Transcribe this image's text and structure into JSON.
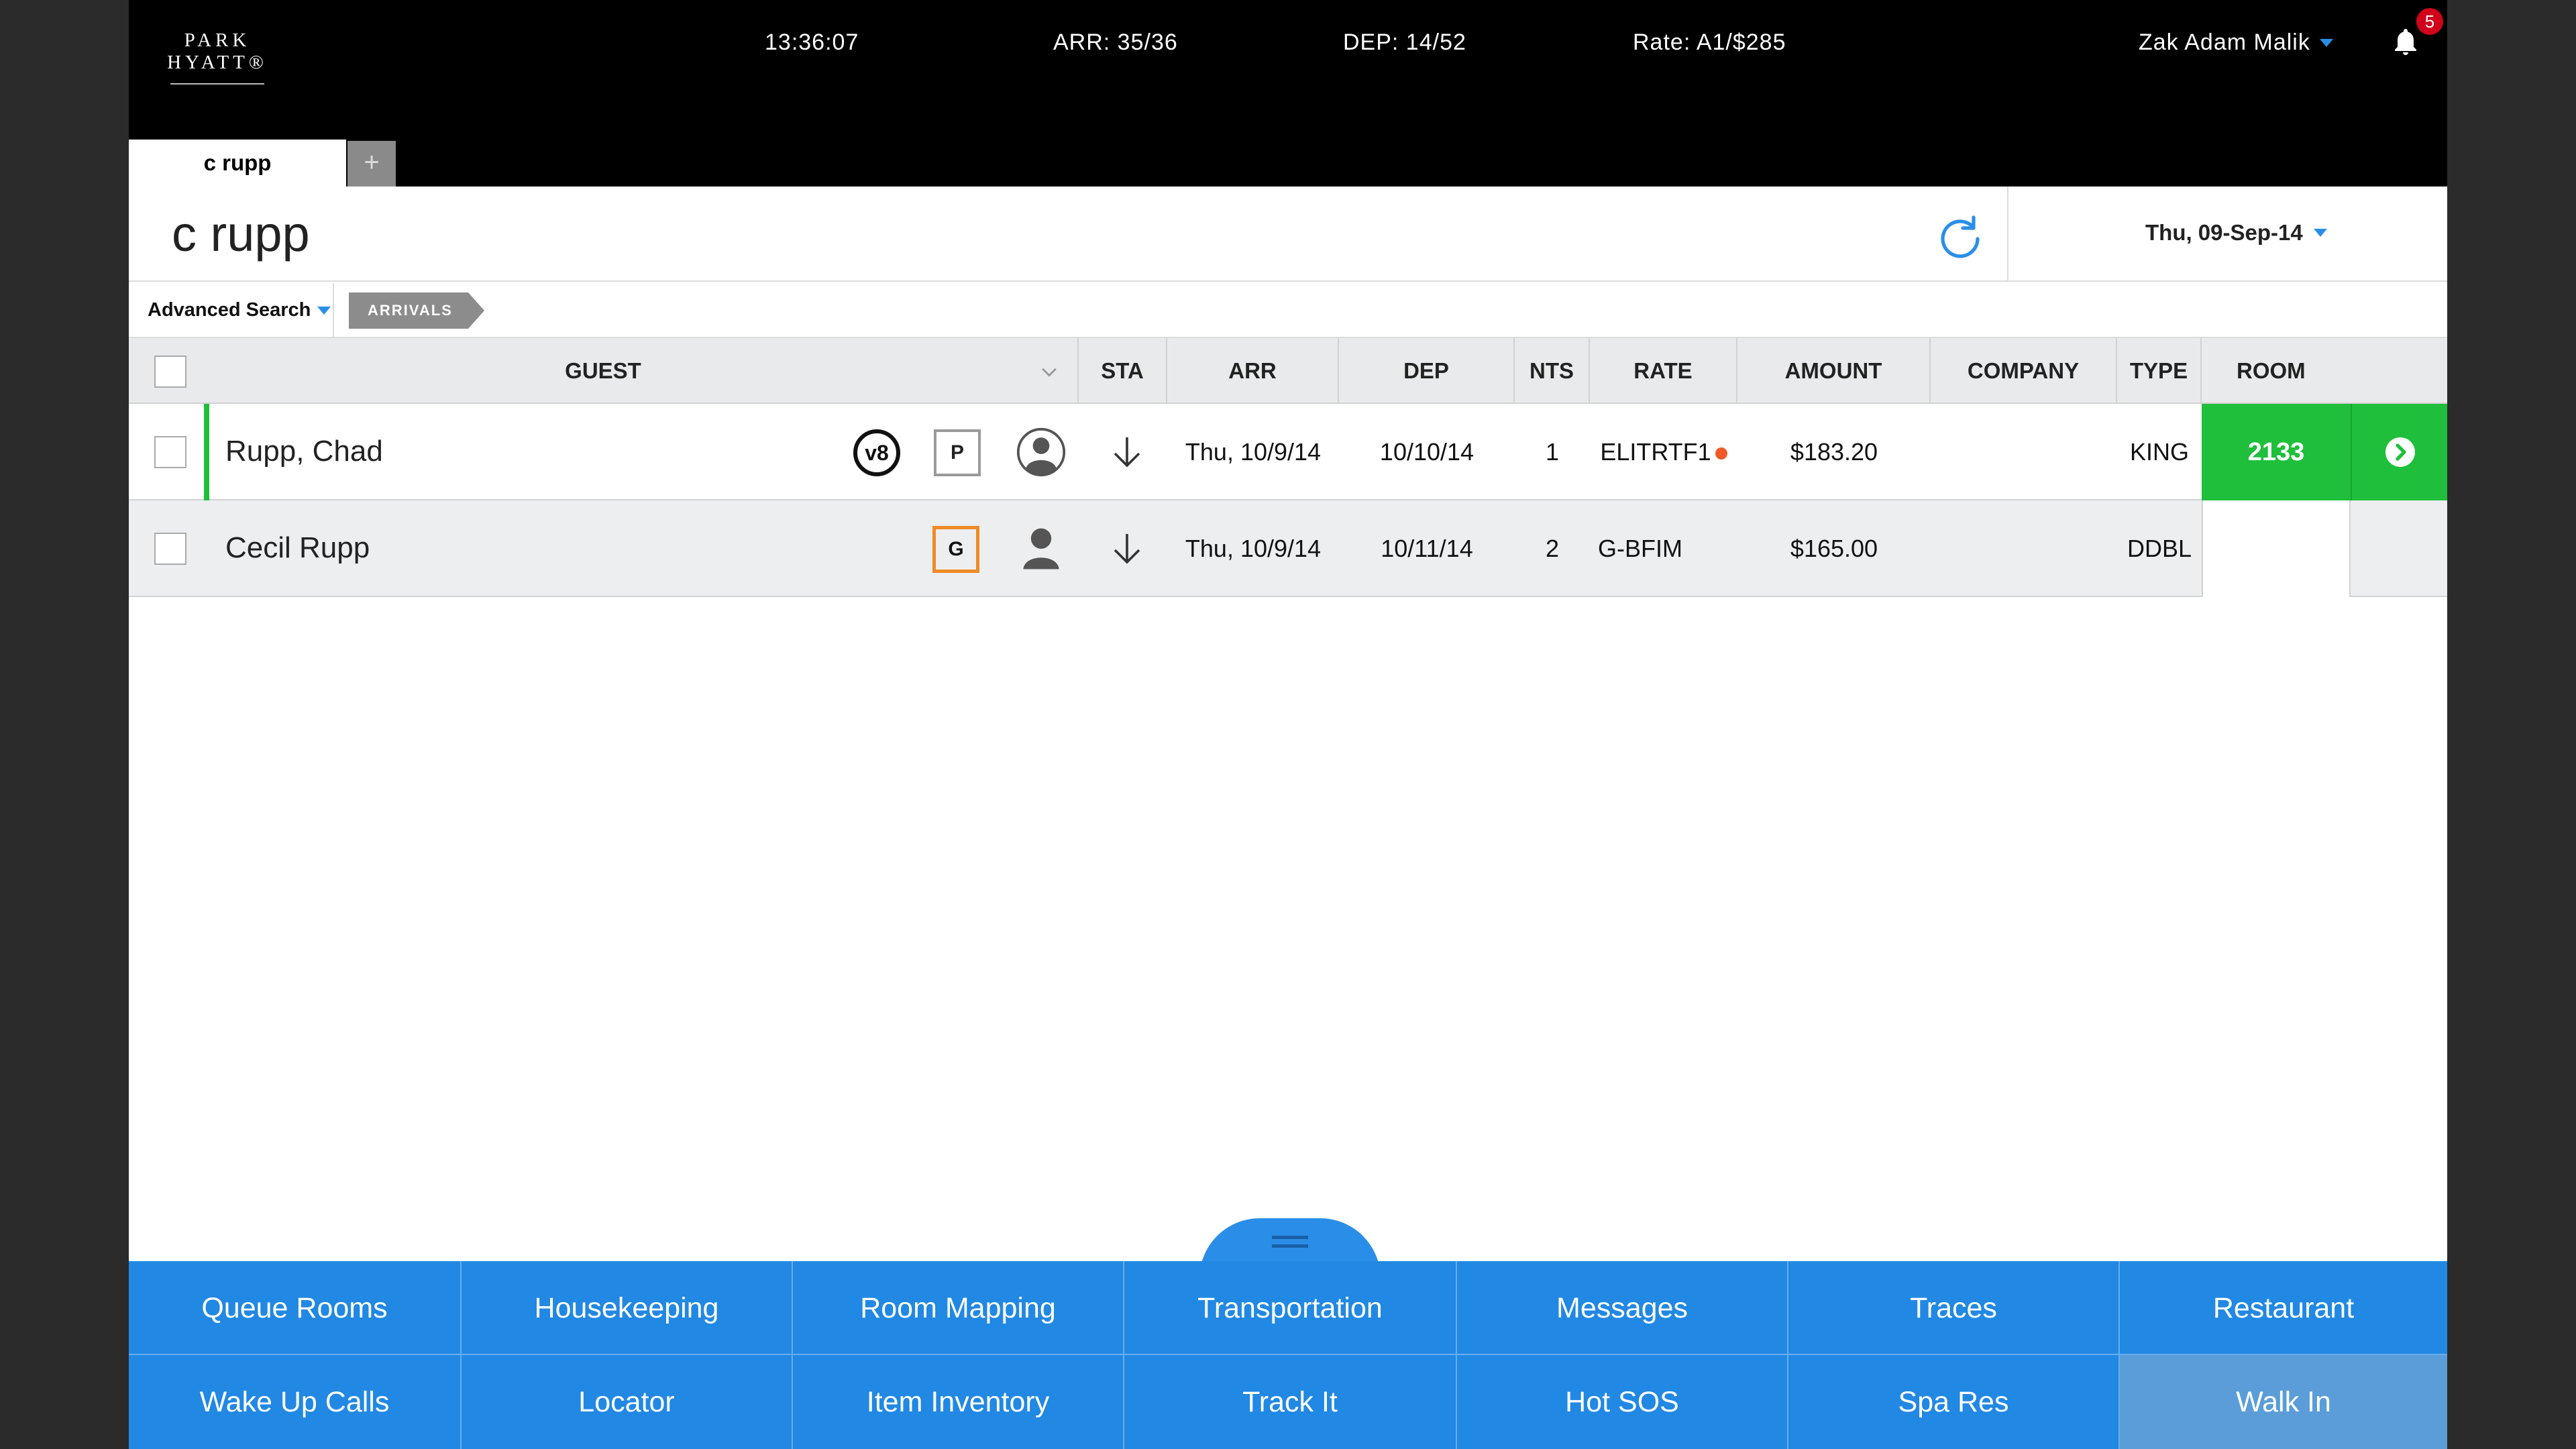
{
  "header": {
    "logo": "PARK HYATT®",
    "time": "13:36:07",
    "arrivals": "ARR: 35/36",
    "departures": "DEP: 14/52",
    "rate": "Rate: A1/$285",
    "user": "Zak Adam Malik",
    "notifications": "5"
  },
  "tabs": {
    "active": "c rupp",
    "add": "+"
  },
  "page": {
    "title": "c rupp",
    "date": "Thu, 09-Sep-14"
  },
  "filters": {
    "advanced_search": "Advanced Search",
    "chip": "ARRIVALS"
  },
  "table": {
    "columns": [
      "GUEST",
      "STA",
      "ARR",
      "DEP",
      "NTS",
      "RATE",
      "AMOUNT",
      "COMPANY",
      "TYPE",
      "ROOM"
    ],
    "rows": [
      {
        "guest": "Rupp, Chad",
        "badge": "v8",
        "profile_letter": "P",
        "arr": "Thu, 10/9/14",
        "dep": "10/10/14",
        "nts": "1",
        "rate": "ELITRTF1",
        "amount": "$183.20",
        "company": "",
        "type": "KING",
        "room": "2133"
      },
      {
        "guest": "Cecil Rupp",
        "profile_letter": "G",
        "arr": "Thu, 10/9/14",
        "dep": "10/11/14",
        "nts": "2",
        "rate": "G-BFIM",
        "amount": "$165.00",
        "company": "",
        "type": "DDBL",
        "room": ""
      }
    ]
  },
  "bottom_nav": {
    "row1": [
      "Queue Rooms",
      "Housekeeping",
      "Room Mapping",
      "Transportation",
      "Messages",
      "Traces",
      "Restaurant"
    ],
    "row2": [
      "Wake Up Calls",
      "Locator",
      "Item Inventory",
      "Track It",
      "Hot SOS",
      "Spa Res",
      "Walk In"
    ]
  },
  "colors": {
    "accent_blue": "#2188e3",
    "status_green": "#1fbf3c",
    "badge_red": "#d0021b",
    "orange": "#f08a24"
  }
}
